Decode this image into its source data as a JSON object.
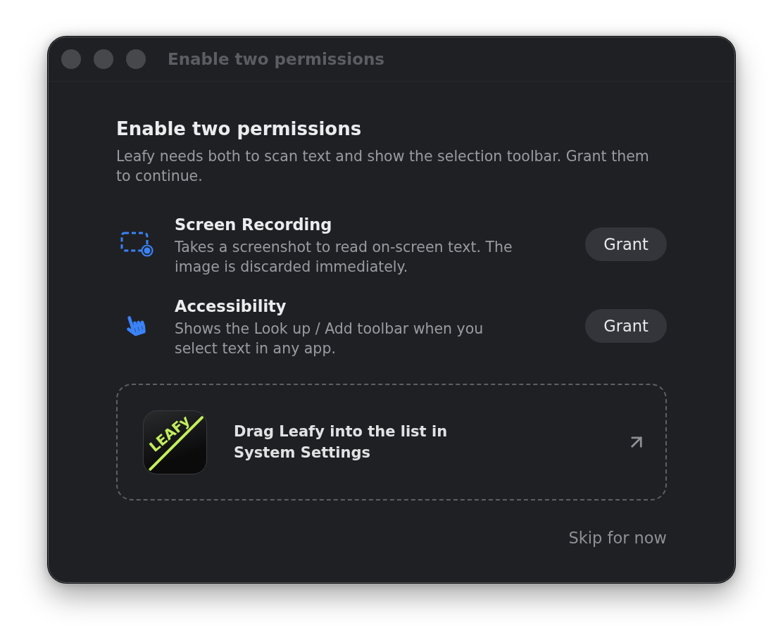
{
  "window": {
    "title": "Enable two permissions"
  },
  "heading": "Enable two permissions",
  "subtitle": "Leafy needs both to scan text and show the selection toolbar. Grant them to continue.",
  "permissions": [
    {
      "kind": "screen_recording",
      "title": "Screen Recording",
      "description": "Takes a screenshot to read on-screen text. The image is discarded immediately.",
      "button": "Grant"
    },
    {
      "kind": "accessibility",
      "title": "Accessibility",
      "description": "Shows the Look up / Add toolbar when you select text in any app.",
      "button": "Grant"
    }
  ],
  "drop_zone": {
    "logo_letters": "LEAFy",
    "text": "Drag Leafy into the list in System Settings"
  },
  "skip_link": "Skip for now"
}
